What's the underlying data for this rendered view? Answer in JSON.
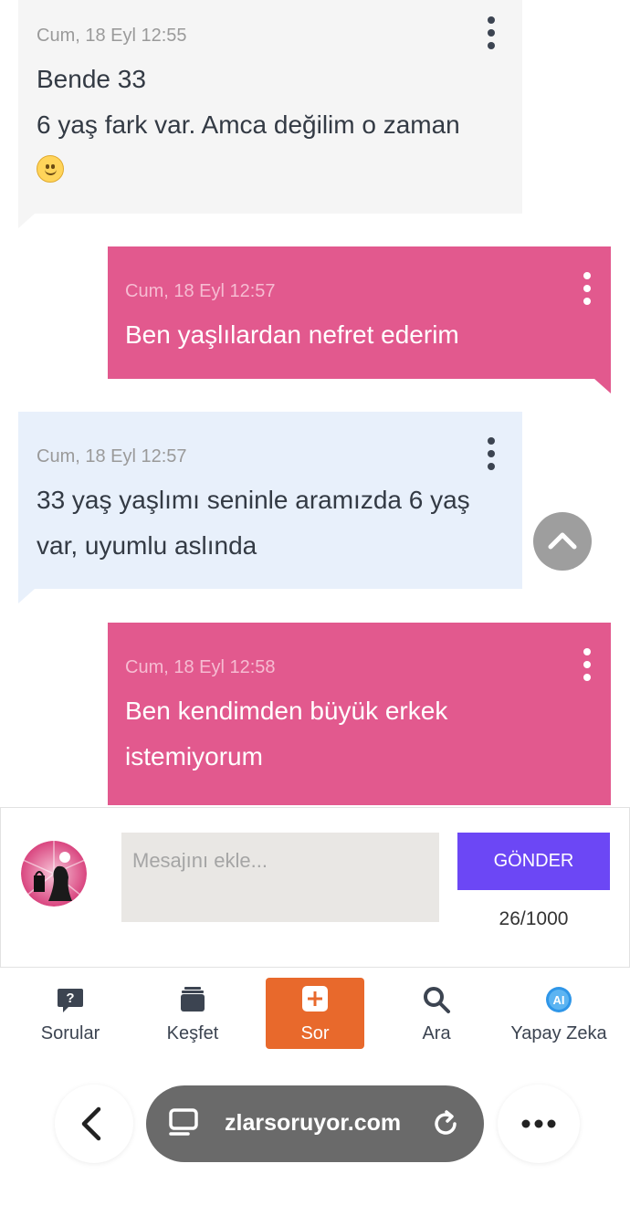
{
  "messages": [
    {
      "time": "Cum, 18 Eyl 12:55",
      "lines": [
        "Bende 33",
        "6 yaş fark var. Amca değilim o zaman"
      ],
      "emoji": "slightly-smiling-face-icon"
    },
    {
      "time": "Cum, 18 Eyl 12:57",
      "lines": [
        "Ben yaşlılardan nefret ederim"
      ]
    },
    {
      "time": "Cum, 18 Eyl 12:57",
      "lines": [
        "33 yaş yaşlımı seninle aramızda 6 yaş",
        "var, uyumlu aslında"
      ]
    },
    {
      "time": "Cum, 18 Eyl 12:58",
      "lines": [
        "Ben kendimden büyük erkek",
        "istemiyorum"
      ]
    }
  ],
  "colors": {
    "received_bg": "#f5f5f5",
    "received_alt_bg": "#e8f0fb",
    "sent_bg": "#e2598e",
    "send_button": "#6c47f5",
    "active_nav": "#e8692c"
  },
  "composer": {
    "placeholder": "Mesajını ekle...",
    "value": "",
    "send_label": "GÖNDER",
    "char_count": "26/1000"
  },
  "nav": [
    {
      "label": "Sorular",
      "icon": "question-bubble-icon"
    },
    {
      "label": "Keşfet",
      "icon": "cards-stack-icon"
    },
    {
      "label": "Sor",
      "icon": "plus-square-icon",
      "active": true
    },
    {
      "label": "Ara",
      "icon": "search-icon"
    },
    {
      "label": "Yapay Zeka",
      "icon": "ai-badge-icon"
    }
  ],
  "browser": {
    "url": "zlarsoruyor.com",
    "icons": [
      "back-chevron-icon",
      "tab-switcher-icon",
      "reload-icon",
      "more-dots-icon"
    ]
  }
}
